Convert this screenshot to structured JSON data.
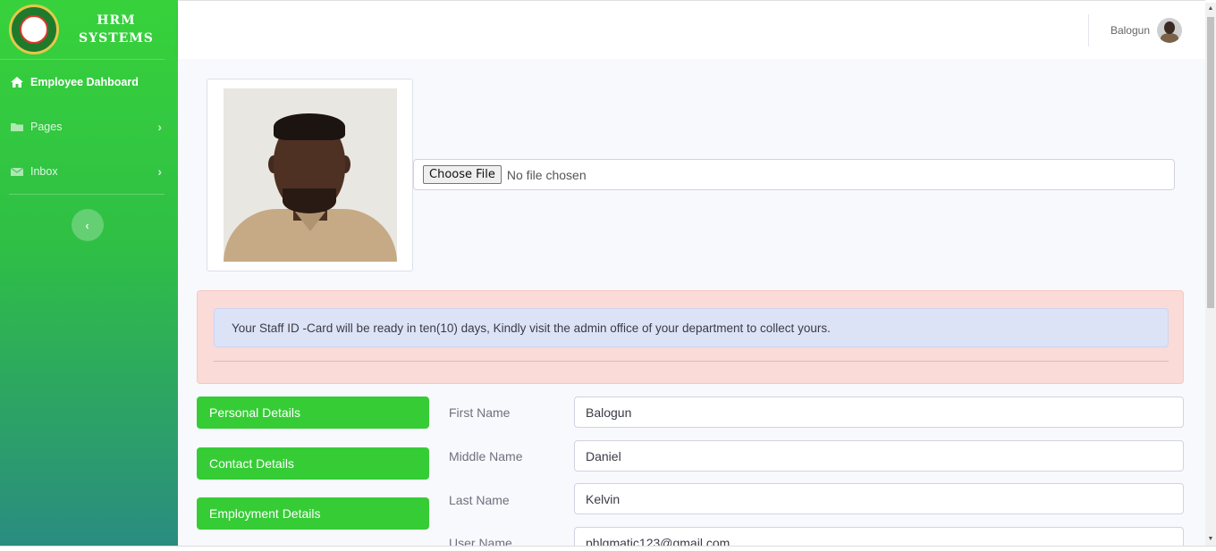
{
  "sidebar": {
    "brand_line1": "HRM",
    "brand_line2": "SYSTEMS",
    "items": [
      {
        "label": "Employee Dahboard",
        "icon": "home-icon"
      },
      {
        "label": "Pages",
        "icon": "folder-icon"
      },
      {
        "label": "Inbox",
        "icon": "envelope-icon"
      }
    ],
    "toggle_icon": "chevron-left-icon"
  },
  "topbar": {
    "username": "Balogun"
  },
  "profile": {
    "file_button": "Choose File",
    "file_status": "No file chosen"
  },
  "alert": {
    "message": "Your Staff ID -Card will be ready in ten(10) days, Kindly visit the admin office of your department to collect yours."
  },
  "tabs": [
    {
      "label": "Personal Details"
    },
    {
      "label": "Contact Details"
    },
    {
      "label": "Employment Details"
    }
  ],
  "form": {
    "fields": [
      {
        "label": "First Name",
        "value": "Balogun"
      },
      {
        "label": "Middle Name",
        "value": "Daniel"
      },
      {
        "label": "Last Name",
        "value": "Kelvin"
      },
      {
        "label": "User Name",
        "value": "phlgmatic123@gmail.com"
      }
    ]
  },
  "colors": {
    "sidebar_top": "#37d23b",
    "sidebar_bottom": "#2a8c80",
    "tab_button": "#36cc36",
    "alert_danger_bg": "#fadbd8",
    "alert_info_bg": "#dde3f7"
  }
}
